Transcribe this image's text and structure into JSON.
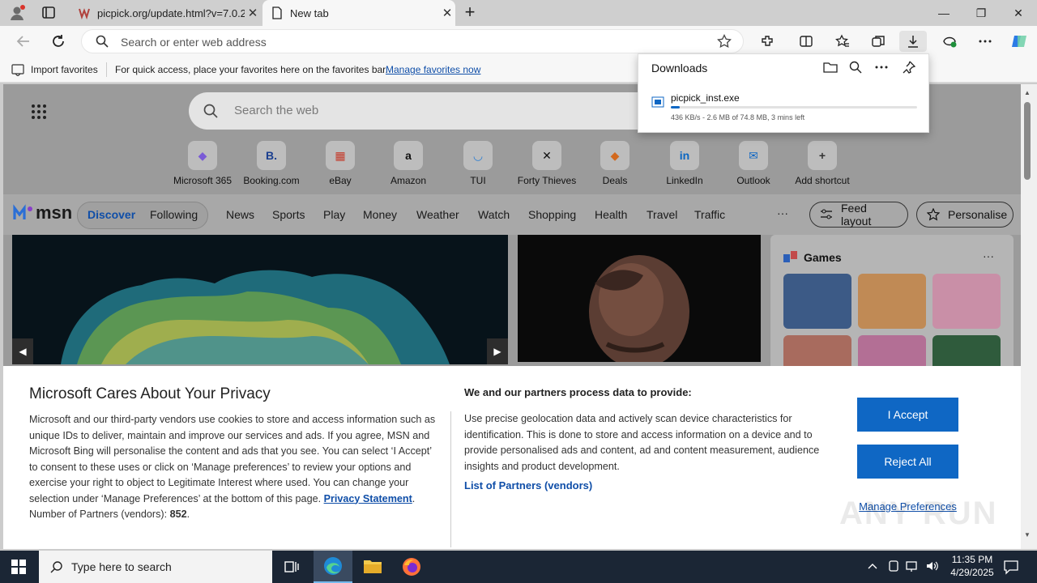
{
  "browser": {
    "tabs": [
      {
        "label": "picpick.org/update.html?v=7.0.2",
        "close": "✕"
      },
      {
        "label": "New tab",
        "close": "✕"
      }
    ],
    "new_tab": "+",
    "window": {
      "minimize": "—",
      "restore": "❐",
      "close": "✕"
    },
    "address": {
      "placeholder": "Search or enter web address"
    },
    "favorites_bar": {
      "import_label": "Import favorites",
      "message": "For quick access, place your favorites here on the favorites bar.",
      "link": "Manage favorites now"
    }
  },
  "downloads": {
    "title": "Downloads",
    "item": {
      "name": "picpick_inst.exe",
      "status": "436 KB/s - 2.6 MB of 74.8 MB, 3 mins left",
      "progress": 0.035
    }
  },
  "newtab": {
    "search_placeholder": "Search the web",
    "quick_links": [
      {
        "label": "Microsoft 365",
        "glyph": "◆",
        "color": "#7a5bd6"
      },
      {
        "label": "Booking.com",
        "glyph": "B.",
        "color": "#1b3f8f"
      },
      {
        "label": "eBay",
        "glyph": "▦",
        "color": "#c43a2a"
      },
      {
        "label": "Amazon",
        "glyph": "a",
        "color": "#111111"
      },
      {
        "label": "TUI",
        "glyph": "◡",
        "color": "#2f7fd1"
      },
      {
        "label": "Forty Thieves",
        "glyph": "✕",
        "color": "#111111"
      },
      {
        "label": "Deals",
        "glyph": "◆",
        "color": "#d2691e"
      },
      {
        "label": "LinkedIn",
        "glyph": "in",
        "color": "#0a66c2"
      },
      {
        "label": "Outlook",
        "glyph": "✉",
        "color": "#0f67c4"
      },
      {
        "label": "Add shortcut",
        "glyph": "+",
        "color": "#333333"
      }
    ],
    "msn": {
      "logo": "msn",
      "tabs": [
        "Discover",
        "Following"
      ],
      "nav": [
        "News",
        "Sports",
        "Play",
        "Money",
        "Weather",
        "Watch",
        "Shopping",
        "Health",
        "Travel",
        "Traffic"
      ],
      "more": "···",
      "feed_layout": "Feed layout",
      "personalise": "Personalise"
    },
    "games": {
      "title": "Games",
      "more": "···"
    }
  },
  "privacy": {
    "title": "Microsoft Cares About Your Privacy",
    "body": "Microsoft and our third-party vendors use cookies to store and access information such as unique IDs to deliver, maintain and improve our services and ads. If you agree, MSN and Microsoft Bing will personalise the content and ads that you see. You can select ‘I Accept’ to consent to these uses or click on ‘Manage preferences’ to review your options and exercise your right to object to Legitimate Interest where used.  You can change your selection under ‘Manage Preferences’ at the bottom of this page.",
    "privacy_link": "Privacy Statement",
    "partners_label": "Number of Partners (vendors):",
    "partners_count": "852",
    "right_title": "We and our partners process data to provide:",
    "right_body": "Use precise geolocation data and actively scan device characteristics for identification. This is done to store and access information on a device and to provide personalised ads and content, ad and content measurement, audience insights and product development.",
    "partners_link": "List of Partners (vendors)",
    "accept": "I Accept",
    "reject": "Reject All",
    "manage": "Manage Preferences"
  },
  "taskbar": {
    "search_placeholder": "Type here to search",
    "time": "11:35 PM",
    "date": "4/29/2025"
  },
  "watermark": "ANY RUN",
  "colors": {
    "accent": "#0f67c4",
    "taskbar": "#1b2635"
  }
}
